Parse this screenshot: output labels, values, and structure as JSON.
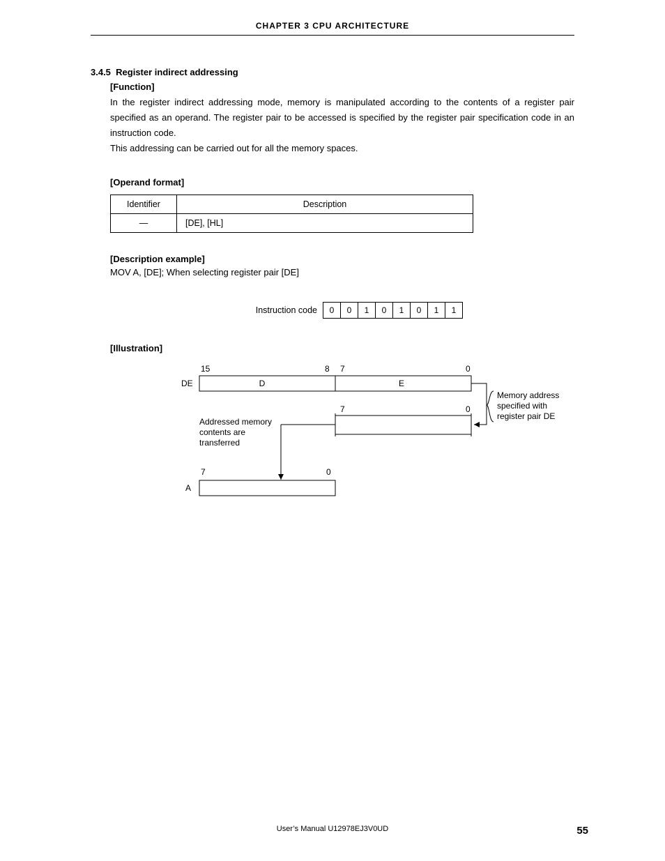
{
  "chapter_header": "CHAPTER  3   CPU  ARCHITECTURE",
  "section": {
    "number": "3.4.5",
    "title": "Register indirect addressing"
  },
  "function": {
    "heading": "[Function]",
    "para1": "In the register indirect addressing mode, memory is manipulated according to the contents of a register pair specified as an operand.  The register pair to be accessed is specified by the register pair specification code in an instruction code.",
    "para2": "This addressing can be carried out for all the memory spaces."
  },
  "operand_format": {
    "heading": "[Operand format]",
    "headers": {
      "id": "Identifier",
      "desc": "Description"
    },
    "row": {
      "id": "—",
      "desc": "[DE], [HL]"
    }
  },
  "description_example": {
    "heading": "[Description example]",
    "line": "MOV A, [DE]; When selecting register pair [DE]",
    "instr_label": "Instruction code",
    "bits": [
      "0",
      "0",
      "1",
      "0",
      "1",
      "0",
      "1",
      "1"
    ]
  },
  "illustration": {
    "heading": "[Illustration]",
    "labels": {
      "bit15": "15",
      "bit8": "8",
      "bit7a": "7",
      "bit0a": "0",
      "reg_de": "DE",
      "reg_d": "D",
      "reg_e": "E",
      "bit7b": "7",
      "bit0b": "0",
      "bit7c": "7",
      "bit0c": "0",
      "reg_a": "A",
      "note_left1": "Addressed memory",
      "note_left2": "contents are",
      "note_left3": "transferred",
      "note_right1": "Memory address",
      "note_right2": "specified with",
      "note_right3": "register pair DE"
    }
  },
  "footer": "User’s Manual  U12978EJ3V0UD",
  "page_number": "55"
}
